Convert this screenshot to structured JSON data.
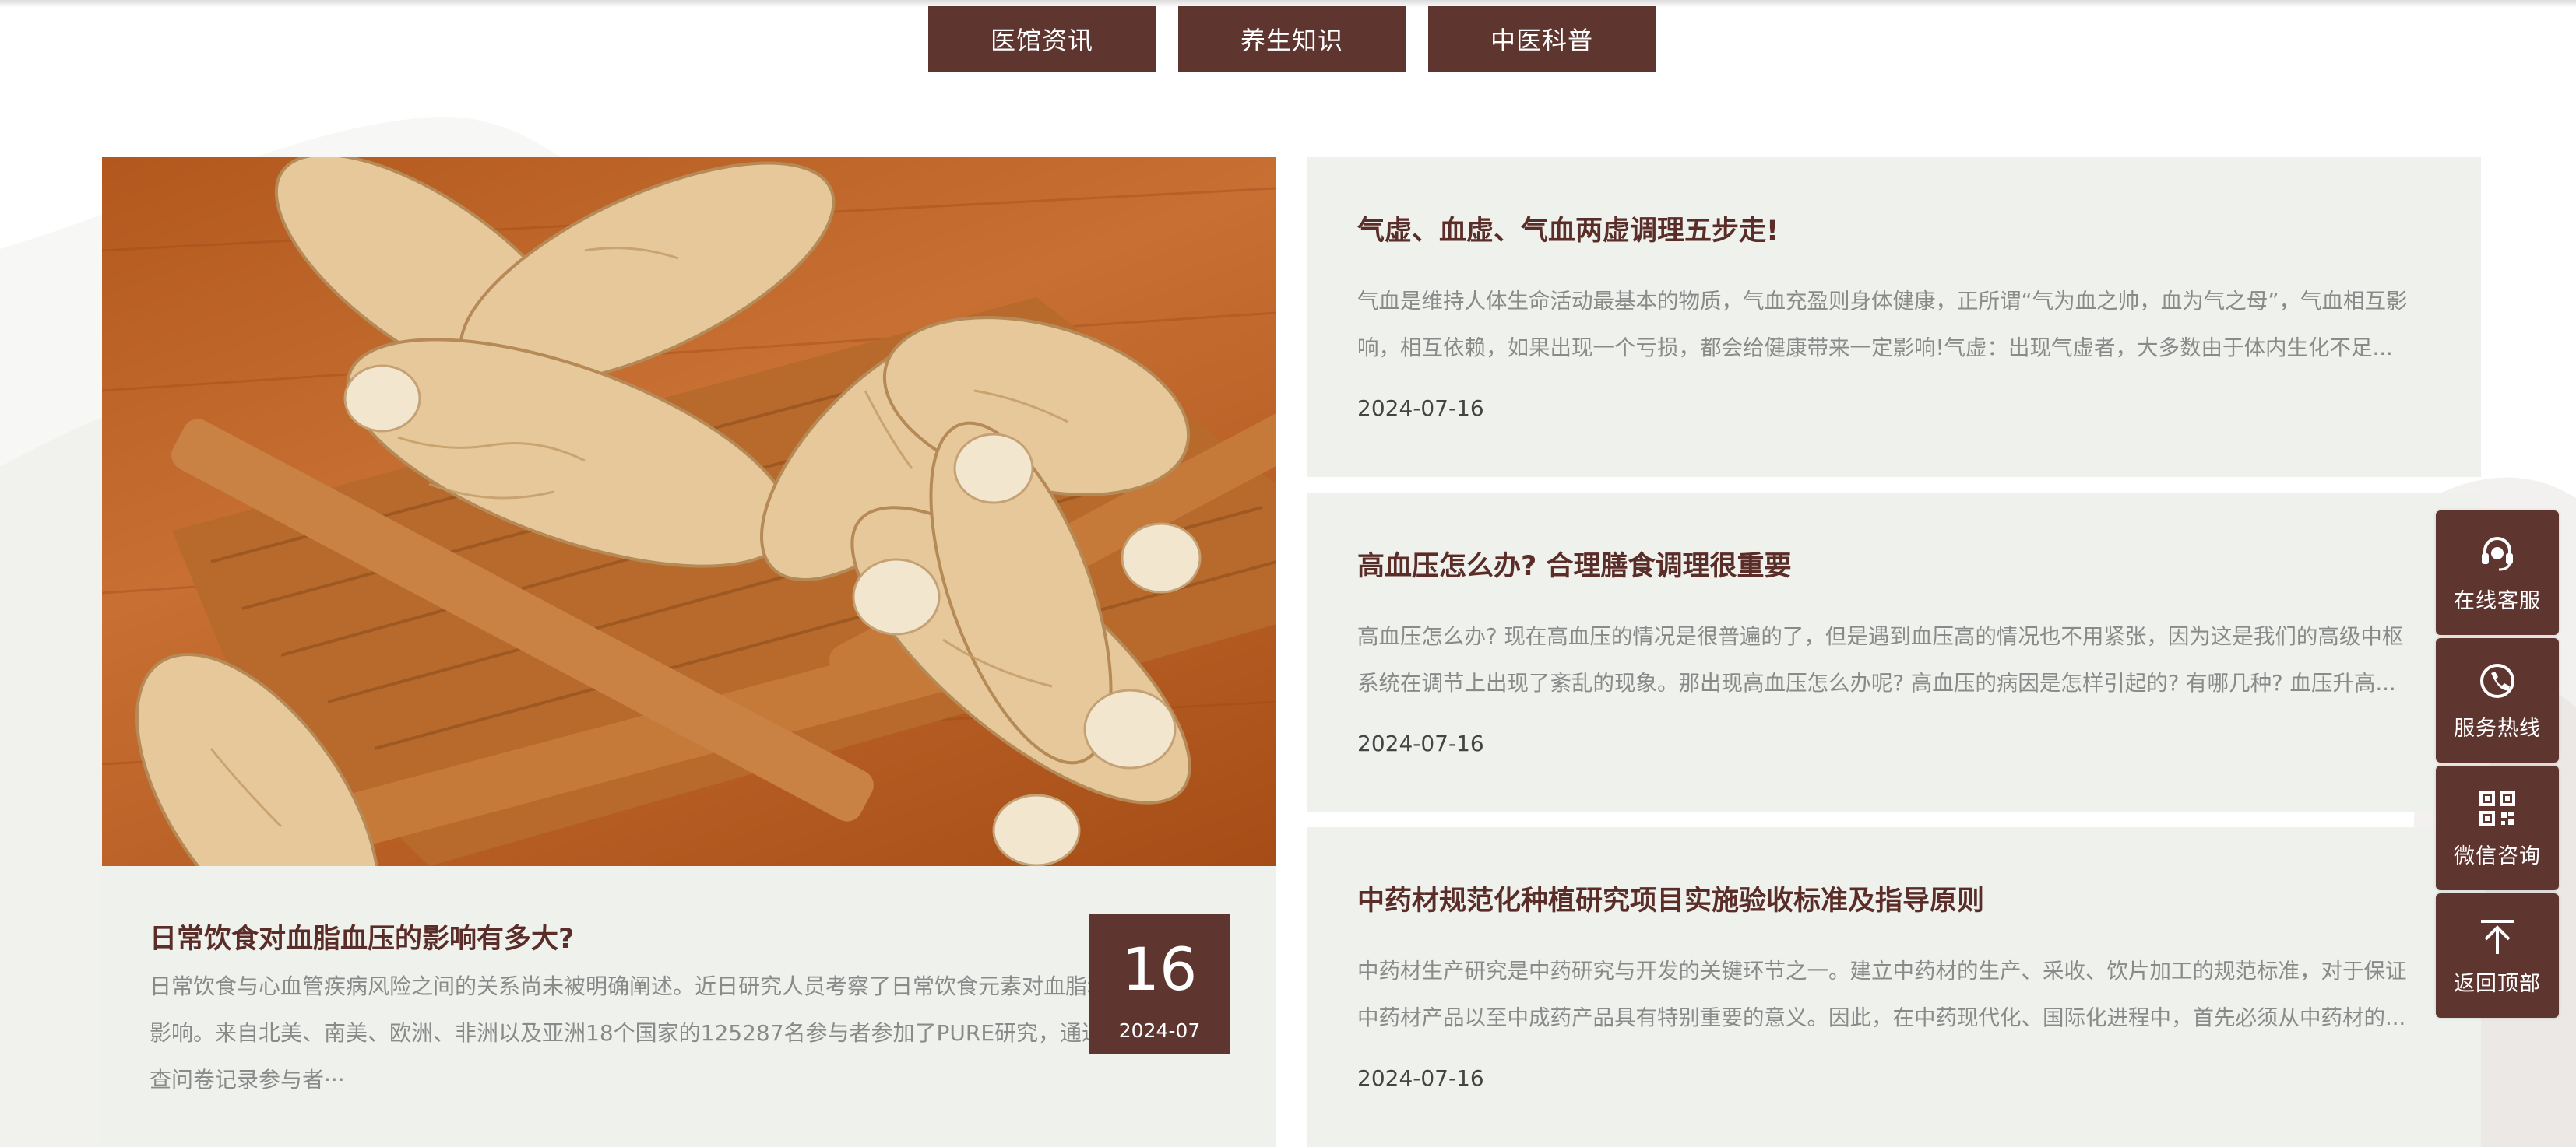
{
  "tabs": [
    {
      "label": "医馆资讯"
    },
    {
      "label": "养生知识"
    },
    {
      "label": "中医科普"
    }
  ],
  "featured": {
    "image": "ginseng-roots-on-bamboo-tray",
    "title": "日常饮食对血脂血压的影响有多大?",
    "description": "日常饮食与心血管疾病风险之间的关系尚未被明确阐述。近日研究人员考察了日常饮食元素对血脂和血压的影响。来自北美、南美、欧洲、非洲以及亚洲18个国家的125287名参与者参加了PURE研究，通过标准调查问卷记录参与者···",
    "day": "16",
    "year_month": "2024-07"
  },
  "news": [
    {
      "title": "气虚、血虚、气血两虚调理五步走!",
      "description": "气血是维持人体生命活动最基本的物质，气血充盈则身体健康，正所谓“气为血之帅，血为气之母”，气血相互影响，相互依赖，如果出现一个亏损，都会给健康带来一定影响!气虚：出现气虚者，大多数由于体内生化不足...",
      "date": "2024-07-16"
    },
    {
      "title": "高血压怎么办? 合理膳食调理很重要",
      "description": "高血压怎么办? 现在高血压的情况是很普遍的了，但是遇到血压高的情况也不用紧张，因为这是我们的高级中枢系统在调节上出现了紊乱的现象。那出现高血压怎么办呢? 高血压的病因是怎样引起的? 有哪几种? 血压升高...",
      "date": "2024-07-16"
    },
    {
      "title": "中药材规范化种植研究项目实施验收标准及指导原则",
      "description": "中药材生产研究是中药研究与开发的关键环节之一。建立中药材的生产、采收、饮片加工的规范标准，对于保证中药材产品以至中成药产品具有特别重要的意义。因此，在中药现代化、国际化进程中，首先必须从中药材的...",
      "date": "2024-07-16"
    }
  ],
  "float_bar": [
    {
      "label": "在线客服",
      "icon": "headset-icon"
    },
    {
      "label": "服务热线",
      "icon": "phone-icon"
    },
    {
      "label": "微信咨询",
      "icon": "qrcode-icon"
    },
    {
      "label": "返回顶部",
      "icon": "arrow-up-icon"
    }
  ],
  "colors": {
    "brand": "#5f3530",
    "card_bg": "#eef1ec",
    "title": "#5a2d29",
    "muted": "#8a8a8a"
  }
}
